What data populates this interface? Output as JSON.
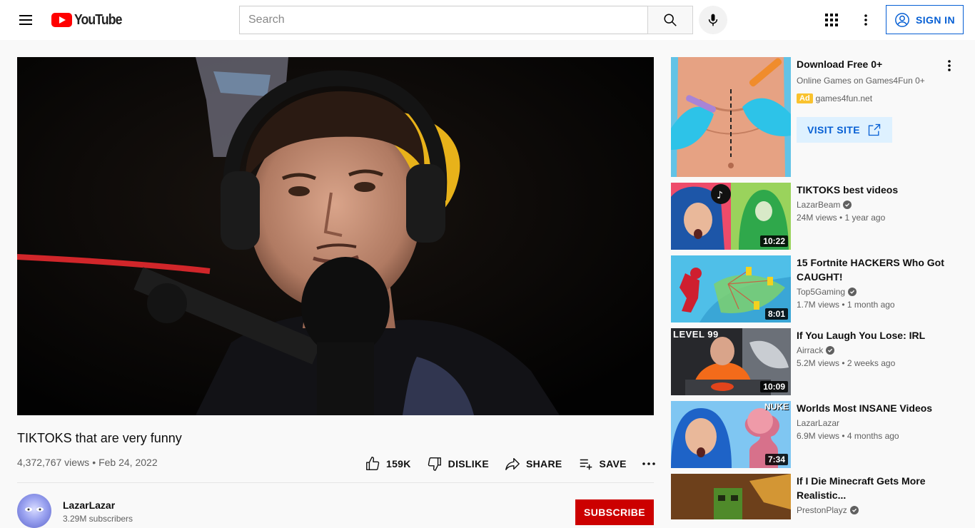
{
  "header": {
    "logo_text": "YouTube",
    "search_placeholder": "Search",
    "signin_label": "SIGN IN"
  },
  "video": {
    "title": "TIKTOKS that are very funny",
    "views": "4,372,767 views",
    "separator": "•",
    "date": "Feb 24, 2022",
    "actions": {
      "like": "159K",
      "dislike": "DISLIKE",
      "share": "SHARE",
      "save": "SAVE"
    }
  },
  "channel": {
    "name": "LazarLazar",
    "subscribers": "3.29M subscribers",
    "subscribe_label": "SUBSCRIBE"
  },
  "ad": {
    "title": "Download Free 0+",
    "description": "Online Games on Games4Fun 0+",
    "badge": "Ad",
    "domain": "games4fun.net",
    "cta": "VISIT SITE"
  },
  "recommendations": [
    {
      "title": "TIKTOKS best videos",
      "channel": "LazarBeam",
      "verified": true,
      "stats": "24M views • 1 year ago",
      "duration": "10:22"
    },
    {
      "title": "15 Fortnite HACKERS Who Got CAUGHT!",
      "channel": "Top5Gaming",
      "verified": true,
      "stats": "1.7M views • 1 month ago",
      "duration": "8:01"
    },
    {
      "title": "If You Laugh You Lose: IRL",
      "channel": "Airrack",
      "verified": true,
      "stats": "5.2M views • 2 weeks ago",
      "duration": "10:09",
      "thumb_text": "LEVEL 99"
    },
    {
      "title": "Worlds Most INSANE Videos",
      "channel": "LazarLazar",
      "verified": false,
      "stats": "6.9M views • 4 months ago",
      "duration": "7:34",
      "thumb_text": "NUKE"
    },
    {
      "title": "If I Die Minecraft Gets More Realistic...",
      "channel": "PrestonPlayz",
      "verified": true,
      "stats": "",
      "duration": ""
    }
  ],
  "colors": {
    "brand_red": "#ff0000",
    "subscribe_red": "#cc0000",
    "link_blue": "#065fd4",
    "ad_badge": "#f9c22e"
  }
}
